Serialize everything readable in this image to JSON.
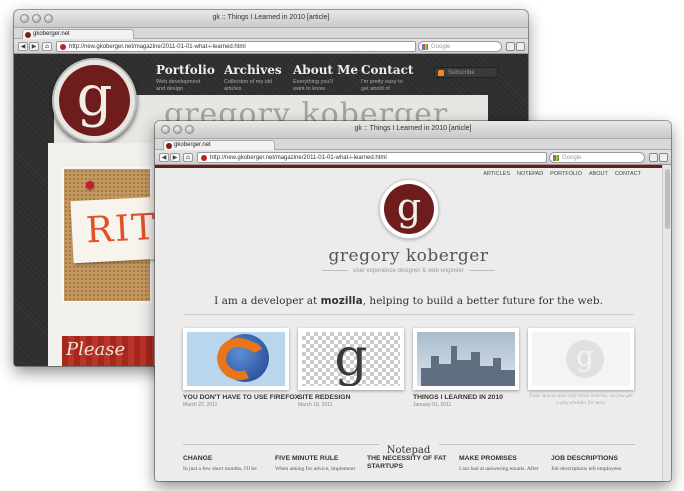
{
  "back_window": {
    "title": "gk :: Things I Learned in 2010 [article]",
    "tab_label": "gkoberger.net",
    "url": "http://new.gkoberger.net/magazine/2011-01-01-what-i-learned.html",
    "search_placeholder": "Google",
    "logo_letter": "g",
    "nav": [
      {
        "title": "Portfolio",
        "desc": "Web development and design"
      },
      {
        "title": "Archives",
        "desc": "Collection of my old articles"
      },
      {
        "title": "About Me",
        "desc": "Everything you'll want to know"
      },
      {
        "title": "Contact",
        "desc": "I'm pretty easy to get ahold of"
      }
    ],
    "subscribe_label": "Subscribe",
    "banner_name": "gregory koberger",
    "note_text": "RIT",
    "please_text": "Please"
  },
  "front_window": {
    "title": "gk :: Things I Learned in 2010 [article]",
    "tab_label": "gkoberger.net",
    "url": "http://new.gkoberger.net/magazine/2011-01-01-what-i-learned.html",
    "search_placeholder": "Google",
    "menu": [
      "ARTICLES",
      "NOTEPAD",
      "PORTFOLIO",
      "ABOUT",
      "CONTACT"
    ],
    "logo_letter": "g",
    "name": "gregory koberger",
    "tagline": "user experience designer & web engineer",
    "intro_before": "I am a developer at ",
    "intro_bold": "mozilla",
    "intro_after": ", helping to build a better future for the web.",
    "articles": [
      {
        "title": "YOU DON'T HAVE TO USE FIREFOX",
        "date": "March 22, 2011"
      },
      {
        "title": "SITE REDESIGN",
        "date": "March 18, 2011",
        "thumb_letter": "g"
      },
      {
        "title": "THINGS I LEARNED IN 2010",
        "date": "January 01, 2011"
      },
      {
        "placeholder": "Four spaces and only three articles; so you get a placeholder for now.",
        "thumb_letter": "g"
      }
    ],
    "notepad_heading": "Notepad",
    "notepad": [
      {
        "title": "CHANGE",
        "text": "In just a few short months, I'll be"
      },
      {
        "title": "FIVE MINUTE RULE",
        "text": "When asking for advice, implement"
      },
      {
        "title": "THE NECESSITY OF FAT STARTUPS",
        "text": ""
      },
      {
        "title": "MAKE PROMISES",
        "text": "I am bad at answering emails. After"
      },
      {
        "title": "JOB DESCRIPTIONS",
        "text": "Job descriptions tell employees"
      }
    ]
  },
  "colors": {
    "brand": "#6e1c1c",
    "page_bg": "#ececec",
    "dark_bg": "#2f2f2f"
  }
}
